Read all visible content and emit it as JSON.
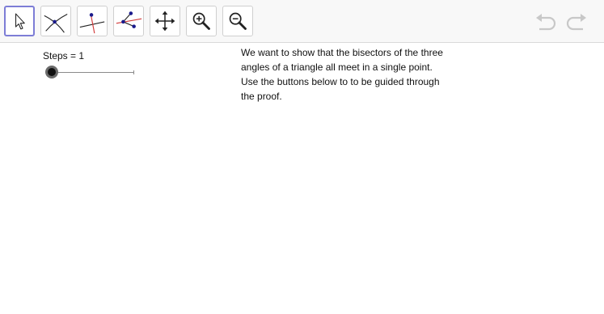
{
  "toolbar": {
    "tools": [
      {
        "icon": "move-pointer-icon",
        "selected": true
      },
      {
        "icon": "intersect-icon",
        "selected": false
      },
      {
        "icon": "perpendicular-bisector-icon",
        "selected": false
      },
      {
        "icon": "angle-bisector-icon",
        "selected": false
      },
      {
        "icon": "move-graphics-view-icon",
        "selected": false
      },
      {
        "icon": "zoom-in-icon",
        "selected": false
      },
      {
        "icon": "zoom-out-icon",
        "selected": false
      }
    ],
    "undo_icon": "undo-icon",
    "redo_icon": "redo-icon"
  },
  "slider": {
    "label": "Steps = 1",
    "value_fraction": 0
  },
  "description": {
    "lines": [
      "We want to show that the bisectors of the three",
      "angles of a triangle all meet in a single point.",
      "Use the buttons below to to be guided through",
      "the proof."
    ]
  },
  "colors": {
    "selected_border": "#7d7dd6",
    "point_blue": "#1a1a8c",
    "line_red": "#d23a3a"
  }
}
